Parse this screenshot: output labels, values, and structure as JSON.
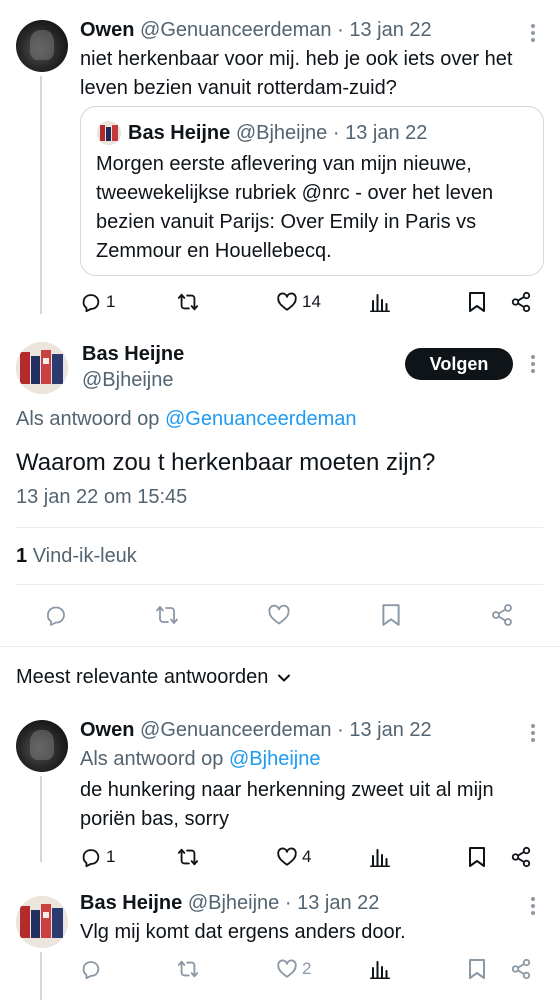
{
  "tweet1": {
    "name": "Owen",
    "handle": "@Genuanceerdeman",
    "sep": "·",
    "date": "13 jan 22",
    "text_line1": "niet herkenbaar voor mij. heb je ook iets over het",
    "text_line2": "leven bezien vanuit rotterdam-zuid?",
    "quote": {
      "name": "Bas Heijne",
      "handle": "@Bjheijne",
      "sep": "·",
      "date": "13 jan 22",
      "line1": "Morgen eerste aflevering van mijn nieuwe,",
      "line2": "tweewekelijkse rubriek @nrc - over het leven",
      "line3": "bezien vanuit Parijs: Over Emily in Paris vs",
      "line4": "Zemmour en Houellebecq."
    },
    "replies": "1",
    "likes": "14"
  },
  "main": {
    "name": "Bas Heijne",
    "handle": "@Bjheijne",
    "follow_label": "Volgen",
    "reply_prefix": "Als antwoord op",
    "reply_to": "@Genuanceerdeman",
    "text": "Waarom zou t herkenbaar moeten zijn?",
    "timestamp": "13 jan 22 om 15:45",
    "likes_count": "1",
    "likes_label": "Vind-ik-leuk"
  },
  "sort": {
    "label": "Meest relevante antwoorden"
  },
  "reply1": {
    "name": "Owen",
    "handle": "@Genuanceerdeman",
    "sep": "·",
    "date": "13 jan 22",
    "reply_prefix": "Als antwoord op",
    "reply_to": "@Bjheijne",
    "line1": "de hunkering naar herkenning zweet uit al mijn",
    "line2": "poriën bas, sorry",
    "replies": "1",
    "likes": "4"
  },
  "reply2": {
    "name": "Bas Heijne",
    "handle": "@Bjheijne",
    "sep": "·",
    "date": "13 jan 22",
    "line1": "Vlg mij komt dat ergens anders door.",
    "likes": "2"
  },
  "colors": {
    "link": "#1d9bf0",
    "muted": "#536471",
    "text": "#0f1419",
    "border": "#cfd9de"
  }
}
